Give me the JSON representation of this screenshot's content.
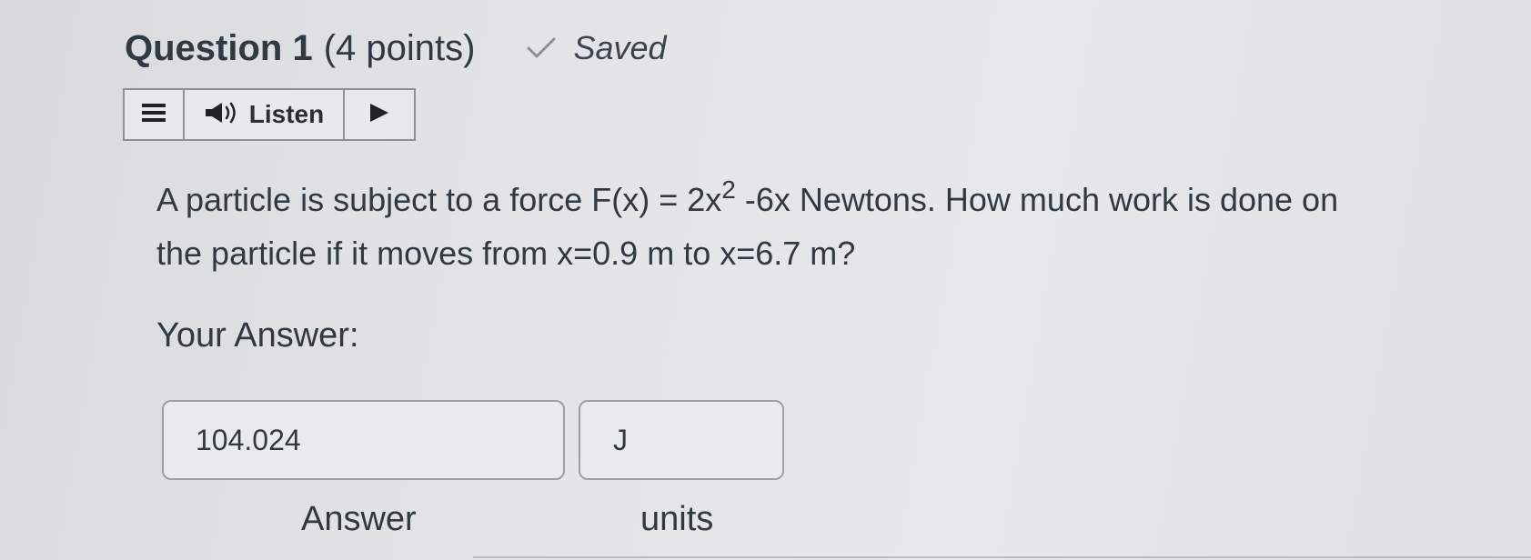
{
  "header": {
    "title": "Question 1",
    "points": "(4 points)",
    "status_icon": "checkmark-icon",
    "status": "Saved"
  },
  "listen_toolbar": {
    "menu_icon": "hamburger-menu-icon",
    "speaker_icon": "speaker-icon",
    "label": "Listen",
    "play_icon": "play-icon"
  },
  "question": {
    "line1_before": "A particle is subject to a force F(x) = 2x",
    "line1_exponent": "2",
    "line1_after": " -6x Newtons. How much work is done on",
    "line2": "the particle if it moves from x=0.9 m to x=6.7 m?"
  },
  "answer": {
    "prompt": "Your Answer:",
    "value": "104.024",
    "units_value": "J",
    "value_caption": "Answer",
    "units_caption": "units"
  }
}
